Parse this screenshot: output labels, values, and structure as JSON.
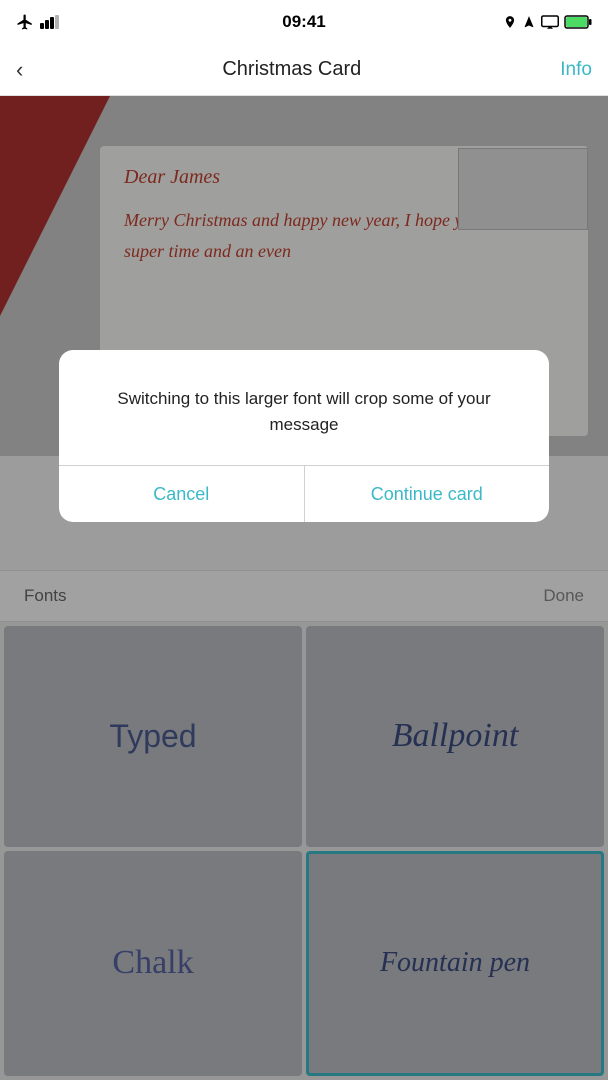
{
  "statusBar": {
    "time": "09:41",
    "battery": "100%"
  },
  "navBar": {
    "title": "Christmas Card",
    "infoLabel": "Info",
    "backLabel": "‹"
  },
  "cardPreview": {
    "dearText": "Dear James",
    "messageText": "Merry Christmas and happy new year, I hope you have a super time and an even"
  },
  "dialog": {
    "message": "Switching to this larger font will crop some of your message",
    "cancelLabel": "Cancel",
    "continueLabel": "Continue card"
  },
  "fontsBar": {
    "fontsLabel": "Fonts",
    "doneLabel": "Done"
  },
  "fontGrid": [
    {
      "id": "typed",
      "label": "Typed",
      "selected": false
    },
    {
      "id": "ballpoint",
      "label": "Ballpoint",
      "selected": false
    },
    {
      "id": "chalk",
      "label": "Chalk",
      "selected": false
    },
    {
      "id": "fountain",
      "label": "Fountain pen",
      "selected": true
    }
  ]
}
